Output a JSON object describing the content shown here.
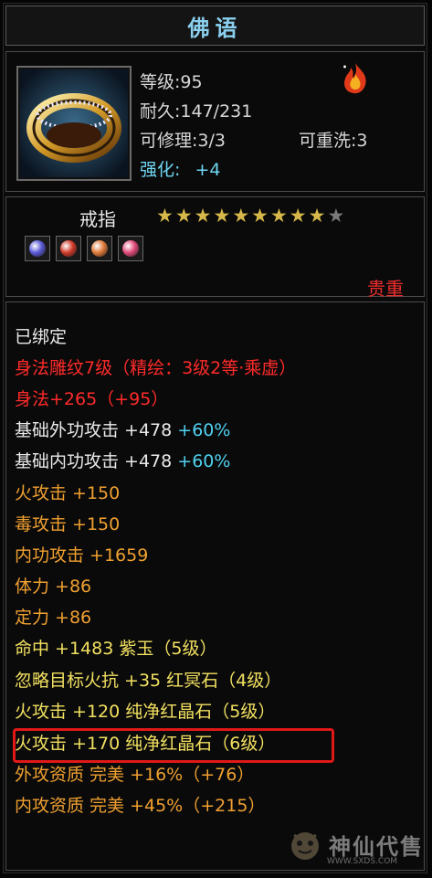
{
  "item": {
    "name": "佛语",
    "level_text": "等级:95",
    "durability_text": "耐久:147/231",
    "repair_text": "可修理:3/3",
    "rewash_text": "可重洗:3",
    "enhance_label": "强化:",
    "enhance_value": "+4",
    "type": "戒指",
    "stars_filled": 9,
    "stars_total": 10,
    "quality": "贵重"
  },
  "gems": [
    {
      "name": "purple-gem",
      "color": "#5a5ad8"
    },
    {
      "name": "red-gem",
      "color": "#d03a2a"
    },
    {
      "name": "orange-gem",
      "color": "#e07a3a"
    },
    {
      "name": "pink-gem",
      "color": "#e04a7a"
    }
  ],
  "attributes": {
    "bound": "已绑定",
    "engrave": "身法雕纹7级（精绘：3级2等·乘虚）",
    "agility": "身法+265（+95）",
    "ext_attack_base": "基础外功攻击 +478",
    "ext_attack_pct": "+60%",
    "int_attack_base": "基础内功攻击 +478",
    "int_attack_pct": "+60%",
    "fire_attack": "火攻击 +150",
    "poison_attack": "毒攻击 +150",
    "internal_attack": "内功攻击 +1659",
    "stamina": "体力 +86",
    "focus": "定力 +86",
    "hit": "命中 +1483 紫玉（5级）",
    "ignore_fire_res": "忽略目标火抗 +35 红冥石（4级）",
    "fire_attack_gem1": "火攻击 +120 纯净红晶石（5级）",
    "fire_attack_gem2": "火攻击 +170 纯净红晶石（6级）",
    "ext_aptitude": "外攻资质  完美 +16%（+76）",
    "int_aptitude": "内攻资质  完美 +45%（+215）"
  },
  "watermark": {
    "text": "神仙代售",
    "url": "WWW.SXDS.COM"
  }
}
